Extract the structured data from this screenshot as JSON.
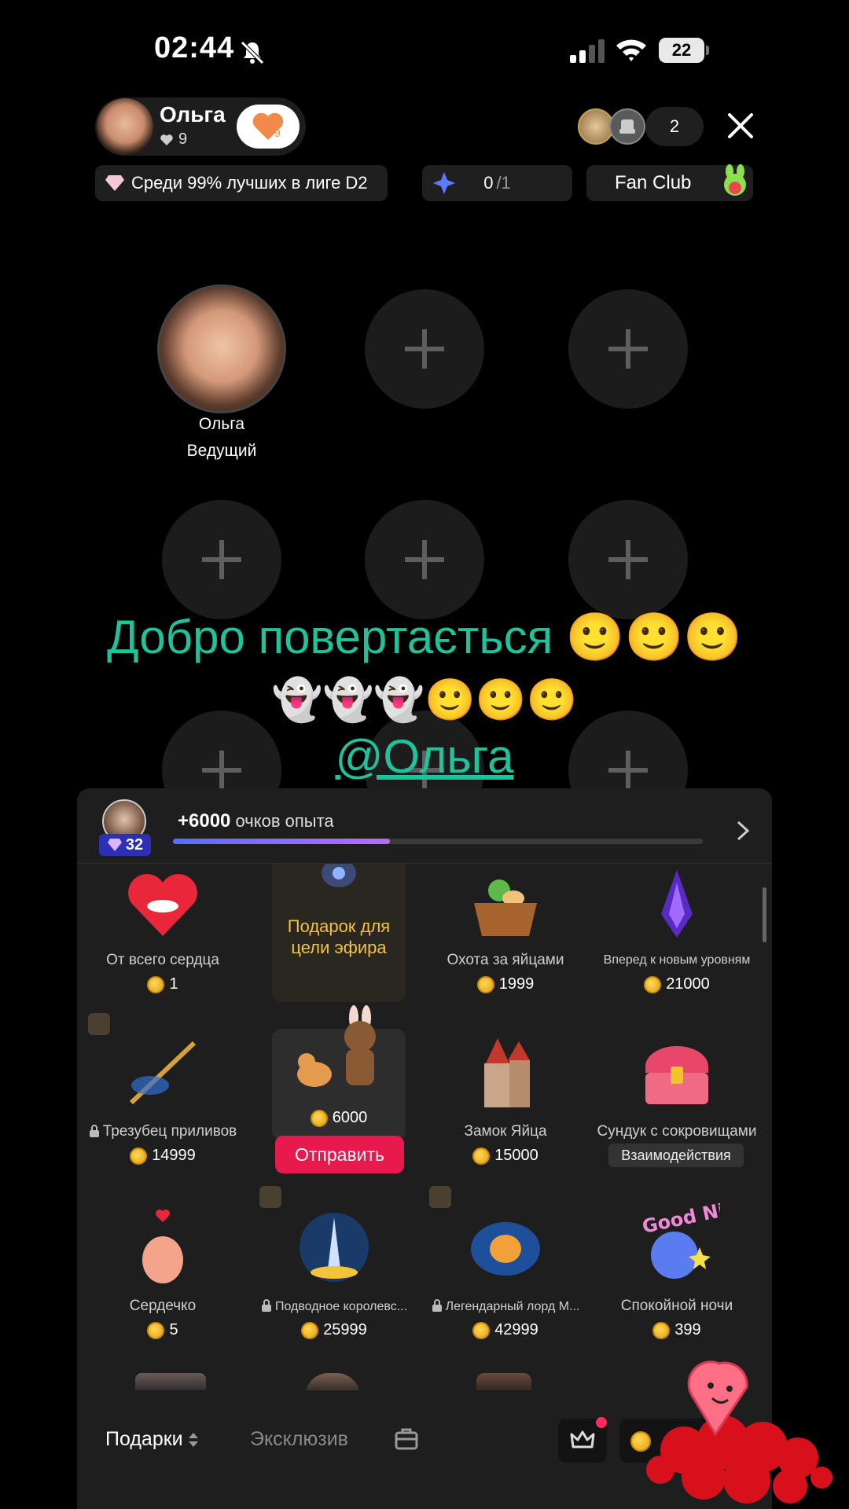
{
  "status_bar": {
    "time": "02:44",
    "battery": "22"
  },
  "host": {
    "name": "Ольга",
    "likes": "9",
    "follow_count": "9"
  },
  "viewers": {
    "count": "2"
  },
  "info": {
    "league": "Среди 99% лучших в лиге D2",
    "goal_done": "0",
    "goal_total": "/1",
    "fan_club": "Fan Club"
  },
  "host_slot": {
    "name": "Ольга",
    "role": "Ведущий"
  },
  "welcome": {
    "line1": "Добро повертається 🙂🙂🙂",
    "line2": "👻👻👻🙂🙂🙂",
    "mention": "@Ольга"
  },
  "xp": {
    "level": "32",
    "points": "+6000",
    "points_label": " очков опыта",
    "progress": 0.41
  },
  "gifts": [
    {
      "name": "От всего сердца",
      "price": "1"
    },
    {
      "goal_text": "Подарок для цели эфира"
    },
    {
      "name": "Охота за яйцами",
      "price": "1999"
    },
    {
      "name": "Вперед к новым уровням",
      "price": "21000"
    },
    {
      "name": "Трезубец приливов",
      "price": "14999"
    },
    {
      "price": "6000",
      "send_label": "Отправить"
    },
    {
      "name": "Замок Яйца",
      "price": "15000"
    },
    {
      "name": "Сундук с сокровищами",
      "action_label": "Взаимодействия"
    },
    {
      "name": "Сердечко",
      "price": "5"
    },
    {
      "name": "Подводное королевс...",
      "price": "25999"
    },
    {
      "name": "Легендарный лорд М...",
      "price": "42999"
    },
    {
      "name": "Спокойной ночи",
      "price": "399"
    }
  ],
  "tabs": {
    "gifts": "Подарки",
    "exclusive": "Эксклюзив"
  },
  "colors": {
    "accent_green": "#1fc29b",
    "send_red": "#e8194d",
    "goal_yellow": "#f5c33a"
  }
}
